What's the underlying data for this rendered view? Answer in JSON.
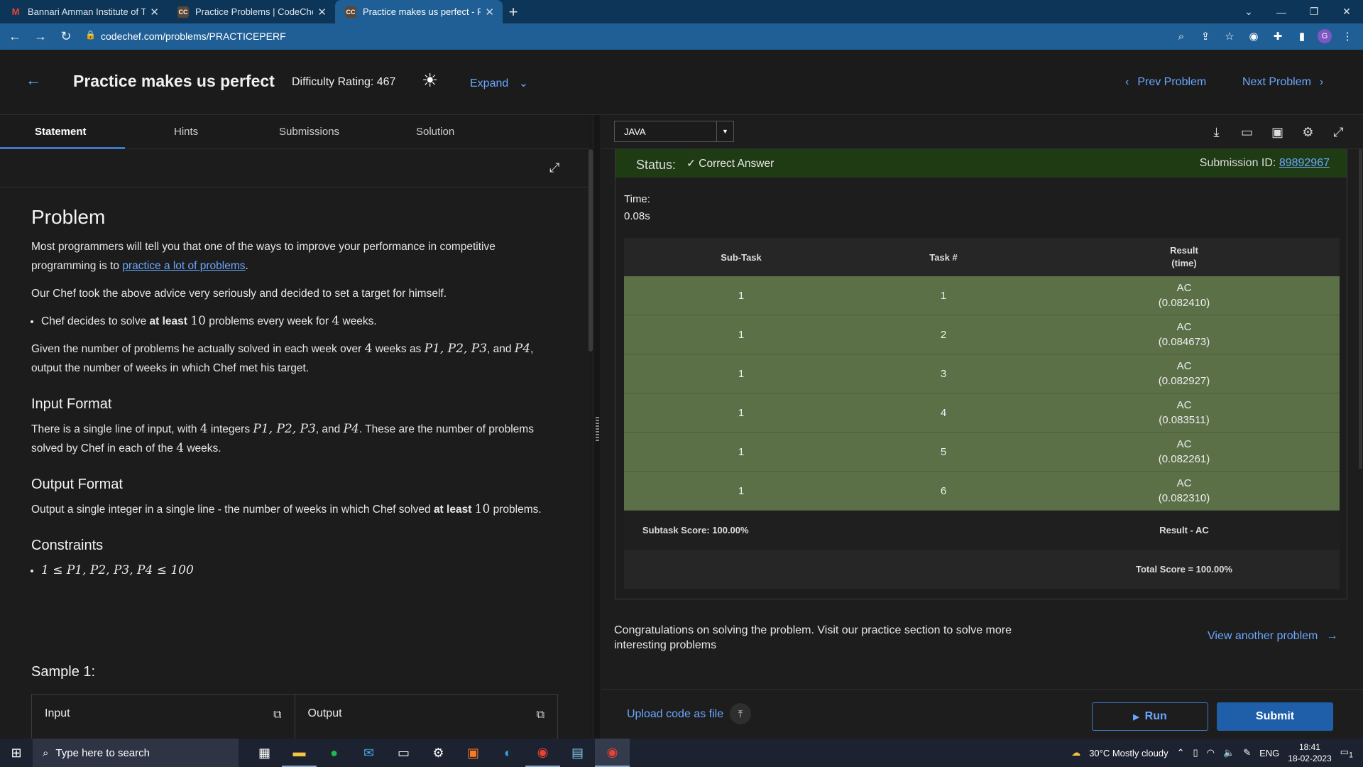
{
  "browser": {
    "tabs": [
      {
        "label": "Bannari Amman Institute of Tech",
        "favicon": "M",
        "favicon_color": "#ea4335"
      },
      {
        "label": "Practice Problems | CodeChef",
        "favicon": "CC",
        "favicon_color": "#ffffff"
      },
      {
        "label": "Practice makes us perfect - Probl",
        "favicon": "CC",
        "favicon_color": "#ffffff"
      }
    ],
    "url": "codechef.com/problems/PRACTICEPERF",
    "profile_initial": "G"
  },
  "header": {
    "title": "Practice makes us perfect",
    "difficulty": "Difficulty Rating: 467",
    "expand": "Expand",
    "prev": "Prev Problem",
    "next": "Next Problem"
  },
  "left_tabs": [
    "Statement",
    "Hints",
    "Submissions",
    "Solution"
  ],
  "problem": {
    "heading": "Problem",
    "p1a": "Most programmers will tell you that one of the ways to improve your performance in competitive programming is to ",
    "p1link": "practice a lot of problems",
    "p1b": ".",
    "p2": "Our Chef took the above advice very seriously and decided to set a target for himself.",
    "bullet_a": "Chef decides to solve ",
    "bullet_bold": "at least",
    "bullet_n1": "10",
    "bullet_b": " problems every week for ",
    "bullet_n2": "4",
    "bullet_c": " weeks.",
    "p3a": "Given the number of problems he actually solved in each week over ",
    "p3n": "4",
    "p3b": " weeks as ",
    "p3vars": "P1, P2, P3",
    "p3and": ", and ",
    "p3last": "P4",
    "p3c": ", output the number of weeks in which Chef met his target.",
    "input_heading": "Input Format",
    "in_a": "There is a single line of input, with ",
    "in_n": "4",
    "in_b": " integers ",
    "in_vars": "P1, P2, P3",
    "in_and": ", and ",
    "in_last": "P4",
    "in_c": ". These are the number of problems solved by Chef in each of the ",
    "in_n2": "4",
    "in_d": " weeks.",
    "output_heading": "Output Format",
    "out_a": "Output a single integer in a single line - the number of weeks in which Chef solved ",
    "out_bold": "at least",
    "out_n": "10",
    "out_b": " problems.",
    "constraints_heading": "Constraints",
    "constraint": "1 ≤ P1, P2, P3, P4 ≤ 100",
    "sample_heading": "Sample 1:",
    "sample_input_label": "Input",
    "sample_output_label": "Output"
  },
  "editor": {
    "language": "JAVA"
  },
  "result": {
    "status_label": "Status:",
    "status_value": "Correct Answer",
    "submission_label": "Submission ID: ",
    "submission_id": "89892967",
    "time_label": "Time:",
    "time_value": "0.08s",
    "columns": [
      "Sub-Task",
      "Task #",
      "Result\n(time)"
    ],
    "rows": [
      {
        "subtask": "1",
        "task": "1",
        "result": "AC",
        "time": "(0.082410)"
      },
      {
        "subtask": "1",
        "task": "2",
        "result": "AC",
        "time": "(0.084673)"
      },
      {
        "subtask": "1",
        "task": "3",
        "result": "AC",
        "time": "(0.082927)"
      },
      {
        "subtask": "1",
        "task": "4",
        "result": "AC",
        "time": "(0.083511)"
      },
      {
        "subtask": "1",
        "task": "5",
        "result": "AC",
        "time": "(0.082261)"
      },
      {
        "subtask": "1",
        "task": "6",
        "result": "AC",
        "time": "(0.082310)"
      }
    ],
    "subtask_score": "Subtask Score: 100.00%",
    "subtask_result": "Result - AC",
    "total_score": "Total Score = 100.00%"
  },
  "footer": {
    "congrats": "Congratulations on solving the problem. Visit our practice section to solve more interesting problems",
    "view_another": "View another problem",
    "upload": "Upload code as file",
    "run": "Run",
    "submit": "Submit"
  },
  "taskbar": {
    "search_placeholder": "Type here to search",
    "weather": "30°C  Mostly cloudy",
    "lang": "ENG",
    "time": "18:41",
    "date": "18-02-2023",
    "notif_count": "1"
  },
  "colors": {
    "accent": "#6aa7ff",
    "status_bg": "#1f3b14",
    "row_bg": "#5c7048",
    "submit_bg": "#1f5faa"
  }
}
